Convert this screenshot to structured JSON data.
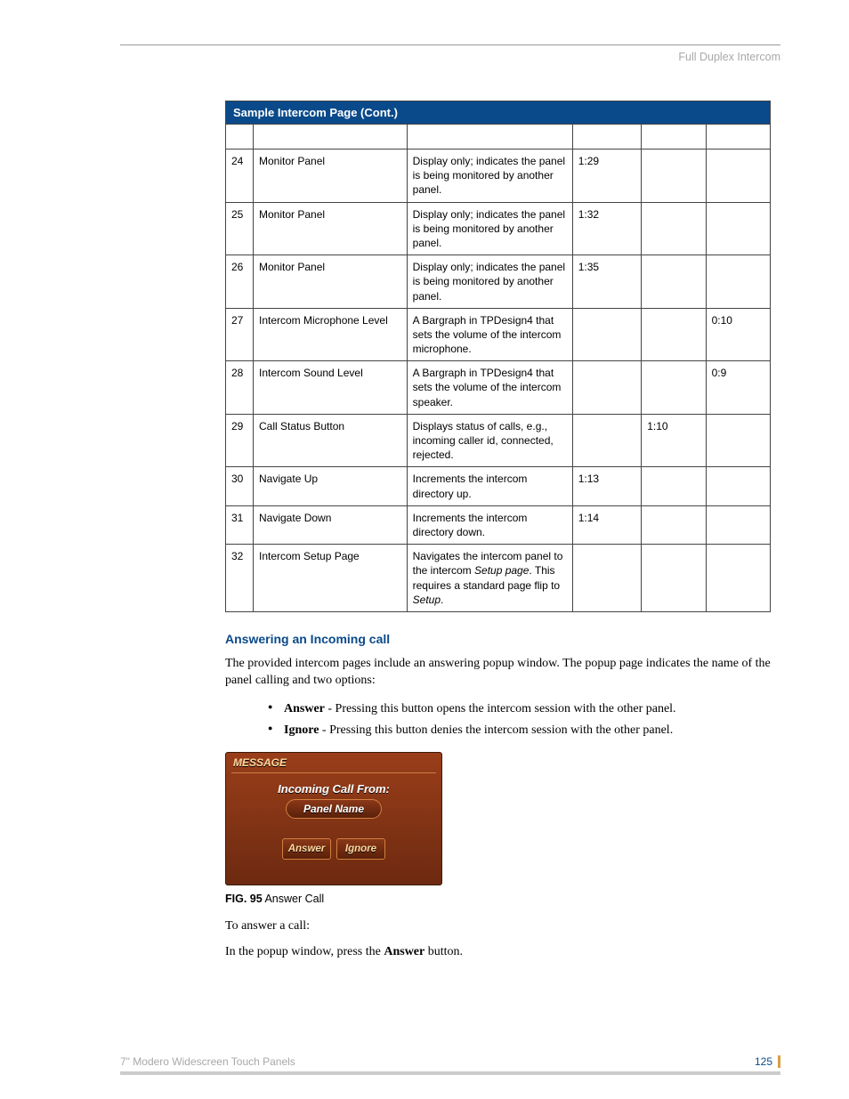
{
  "header": {
    "section": "Full Duplex Intercom"
  },
  "table": {
    "title": "Sample Intercom Page (Cont.)",
    "rows": [
      {
        "num": "24",
        "name": "Monitor Panel",
        "func": "Display only; indicates the panel is being monitored by another panel.",
        "ch": "1:29",
        "addr": "",
        "lvl": ""
      },
      {
        "num": "25",
        "name": "Monitor Panel",
        "func": "Display only; indicates the panel is being monitored by another panel.",
        "ch": "1:32",
        "addr": "",
        "lvl": ""
      },
      {
        "num": "26",
        "name": "Monitor Panel",
        "func": "Display only; indicates the panel is being monitored by another panel.",
        "ch": "1:35",
        "addr": "",
        "lvl": ""
      },
      {
        "num": "27",
        "name": "Intercom Microphone Level",
        "func": "A Bargraph in TPDesign4 that sets the volume of the intercom microphone.",
        "ch": "",
        "addr": "",
        "lvl": "0:10"
      },
      {
        "num": "28",
        "name": "Intercom Sound Level",
        "func": "A Bargraph in TPDesign4 that sets the volume of the intercom speaker.",
        "ch": "",
        "addr": "",
        "lvl": "0:9"
      },
      {
        "num": "29",
        "name": "Call Status Button",
        "func": "Displays status of calls, e.g., incoming caller id, connected, rejected.",
        "ch": "",
        "addr": "1:10",
        "lvl": ""
      },
      {
        "num": "30",
        "name": "Navigate Up",
        "func": "Increments the intercom directory up.",
        "ch": "1:13",
        "addr": "",
        "lvl": ""
      },
      {
        "num": "31",
        "name": "Navigate Down",
        "func": "Increments the intercom directory down.",
        "ch": "1:14",
        "addr": "",
        "lvl": ""
      },
      {
        "num": "32",
        "name": "Intercom Setup Page",
        "func": "Navigates the intercom panel to the intercom Setup page. This requires a standard page flip to Setup.",
        "ch": "",
        "addr": "",
        "lvl": ""
      }
    ]
  },
  "section": {
    "heading": "Answering an Incoming call",
    "intro": "The provided intercom pages include an answering popup window. The popup page indicates the name of the panel calling and two options:",
    "bullets": [
      {
        "bold": "Answer",
        "text": " - Pressing this button opens the intercom session with the other panel."
      },
      {
        "bold": "Ignore",
        "text": " - Pressing this button denies the intercom session with the other panel."
      }
    ],
    "popup": {
      "title": "MESSAGE",
      "label": "Incoming Call From:",
      "panel": "Panel Name",
      "answer": "Answer",
      "ignore": "Ignore"
    },
    "fig_num": "FIG. 95",
    "fig_caption": "  Answer Call",
    "p2": "To answer a call:",
    "p3_a": "In the popup window, press the ",
    "p3_b": "Answer",
    "p3_c": " button."
  },
  "footer": {
    "left": "7\" Modero Widescreen Touch Panels",
    "page": "125"
  }
}
